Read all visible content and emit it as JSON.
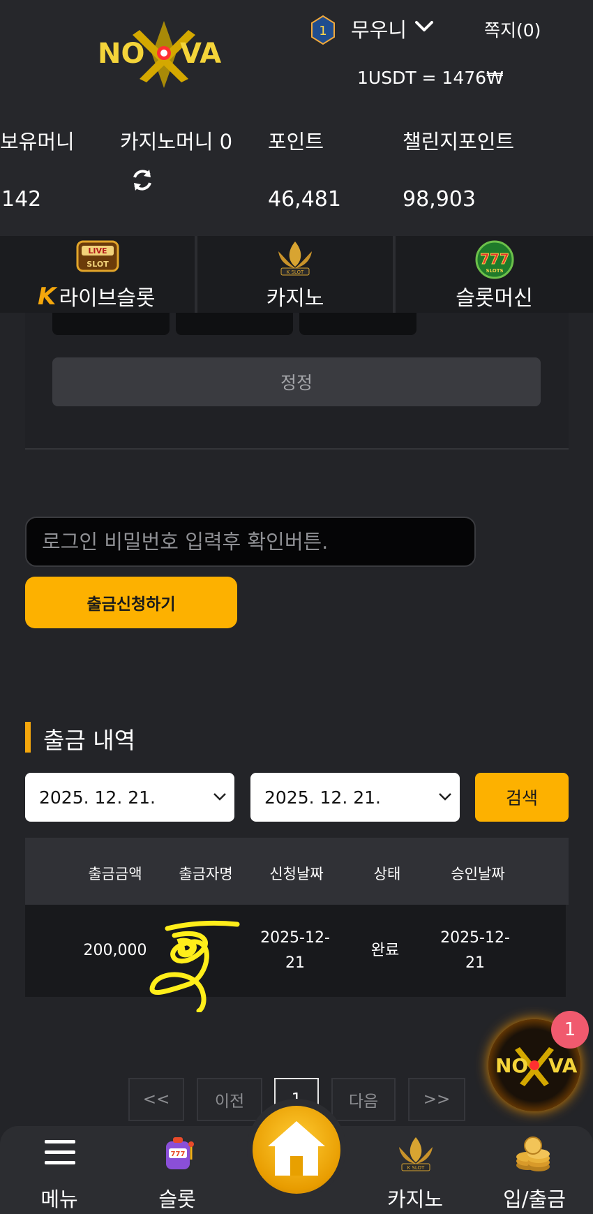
{
  "header": {
    "level": "1",
    "username": "무우니",
    "messages": "쪽지(0)",
    "rate": "1USDT = 1476₩",
    "logo_text": "NOVA"
  },
  "stats": [
    {
      "label": "보유머니",
      "value": "142"
    },
    {
      "label": "카지노머니 0",
      "value": ""
    },
    {
      "label": "포인트",
      "value": "46,481"
    },
    {
      "label": "챌린지포인트",
      "value": "98,903"
    }
  ],
  "categories": [
    {
      "label": "라이브슬롯",
      "icon_text": "LIVE SLOT"
    },
    {
      "label": "카지노",
      "icon_text": "K SLOT"
    },
    {
      "label": "슬롯머신",
      "icon_text": "777"
    }
  ],
  "amount": {
    "correct_label": "정정"
  },
  "withdraw": {
    "password_placeholder": "로그인 비밀번호 입력후 확인버튼.",
    "submit_label": "출금신청하기"
  },
  "history": {
    "title": "출금 내역",
    "date_from": "2025. 12. 21.",
    "date_to": "2025. 12. 21.",
    "search_label": "검색",
    "columns": [
      "출금금액",
      "출금자명",
      "신청날짜",
      "상태",
      "승인날짜"
    ],
    "rows": [
      {
        "amount": "200,000",
        "name": "",
        "requested_line1": "2025-12-",
        "requested_line2": "21",
        "status": "완료",
        "approved_line1": "2025-12-",
        "approved_line2": "21"
      }
    ]
  },
  "pagination": {
    "first": "<<",
    "prev": "이전",
    "current": "1",
    "next": "다음",
    "last": ">>"
  },
  "floating": {
    "badge_count": "1"
  },
  "bottom_nav": {
    "menu": "메뉴",
    "slot": "슬롯",
    "casino": "카지노",
    "deposit_withdraw": "입/출금"
  },
  "colors": {
    "accent": "#fdb100",
    "background": "#232428",
    "badge": "#f05a6e"
  }
}
